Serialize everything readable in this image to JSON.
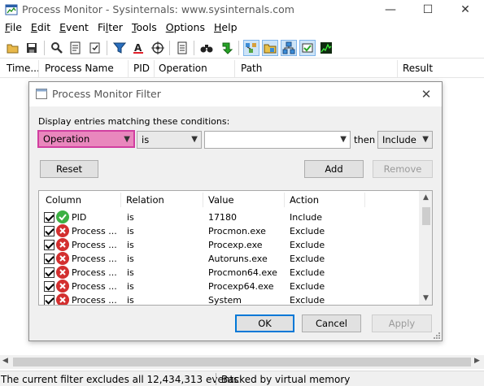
{
  "window": {
    "title": "Process Monitor - Sysinternals: www.sysinternals.com",
    "controls": {
      "minimize": "—",
      "maximize": "☐",
      "close": "✕"
    }
  },
  "menubar": [
    {
      "key": "F",
      "rest": "ile"
    },
    {
      "key": "E",
      "rest": "dit"
    },
    {
      "key": "E",
      "rest": "vent"
    },
    {
      "key": "",
      "pre": "Fi",
      "key2": "l",
      "rest": "ter"
    },
    {
      "key": "T",
      "rest": "ools"
    },
    {
      "key": "O",
      "rest": "ptions"
    },
    {
      "key": "H",
      "rest": "elp"
    }
  ],
  "toolbar": {
    "buttons": [
      "open-icon",
      "save-icon",
      "magnifier-icon",
      "autoscroll-icon",
      "clear-icon",
      "filter-icon",
      "highlight-icon",
      "target-icon",
      "properties-icon",
      "find-icon",
      "jump-icon",
      "registry-activity-icon",
      "file-activity-icon",
      "network-activity-icon",
      "process-activity-icon",
      "profiling-icon"
    ]
  },
  "columns": [
    "Time...",
    "Process Name",
    "PID",
    "Operation",
    "Path",
    "Result"
  ],
  "dialog": {
    "title": "Process Monitor Filter",
    "caption": "Display entries matching these conditions:",
    "column_value": "Operation",
    "relation_value": "is",
    "value_input": "",
    "then_label": "then",
    "action_value": "Include",
    "buttons": {
      "reset": "Reset",
      "add": "Add",
      "remove": "Remove",
      "ok": "OK",
      "cancel": "Cancel",
      "apply": "Apply"
    },
    "list_headers": [
      "Column",
      "Relation",
      "Value",
      "Action"
    ],
    "rows": [
      {
        "column": "PID",
        "relation": "is",
        "value": "17180",
        "action": "Include",
        "status": "include",
        "checked": true
      },
      {
        "column": "Process ...",
        "relation": "is",
        "value": "Procmon.exe",
        "action": "Exclude",
        "status": "exclude",
        "checked": true
      },
      {
        "column": "Process ...",
        "relation": "is",
        "value": "Procexp.exe",
        "action": "Exclude",
        "status": "exclude",
        "checked": true
      },
      {
        "column": "Process ...",
        "relation": "is",
        "value": "Autoruns.exe",
        "action": "Exclude",
        "status": "exclude",
        "checked": true
      },
      {
        "column": "Process ...",
        "relation": "is",
        "value": "Procmon64.exe",
        "action": "Exclude",
        "status": "exclude",
        "checked": true
      },
      {
        "column": "Process ...",
        "relation": "is",
        "value": "Procexp64.exe",
        "action": "Exclude",
        "status": "exclude",
        "checked": true
      },
      {
        "column": "Process ...",
        "relation": "is",
        "value": "System",
        "action": "Exclude",
        "status": "exclude",
        "checked": true
      }
    ]
  },
  "status": {
    "filter_text": "The current filter excludes all 12,434,313 events",
    "memory_text": "Backed by virtual memory"
  },
  "colors": {
    "highlight_combo": "#e987bd",
    "include_icon": "#3cb043",
    "exclude_icon": "#d32f2f",
    "default_button_border": "#0078d7"
  }
}
